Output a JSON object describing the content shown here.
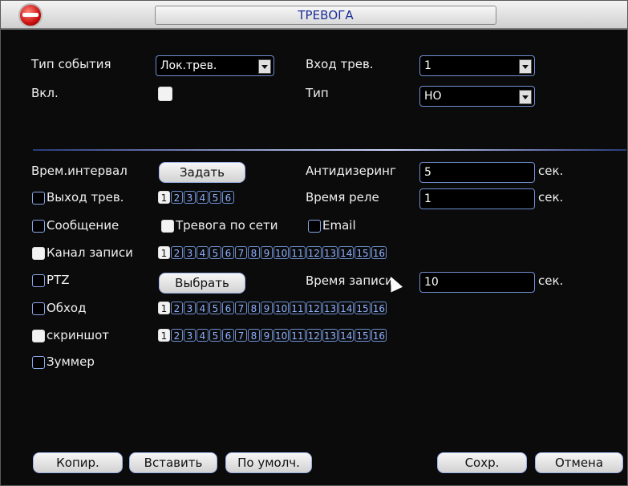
{
  "window": {
    "title": "ТРЕВОГА"
  },
  "row1": {
    "event_type_label": "Тип события",
    "event_type_value": "Лок.трев.",
    "alarm_in_label": "Вход трев.",
    "alarm_in_value": "1"
  },
  "row2": {
    "enable_label": "Вкл.",
    "type_label": "Тип",
    "type_value": "НО"
  },
  "period": {
    "label": "Врем.интервал",
    "button": "Задать",
    "debounce_label": "Антидизеринг",
    "debounce_value": "5",
    "debounce_unit": "сек."
  },
  "alarm_out": {
    "label": "Выход трев.",
    "channels": [
      "1",
      "2",
      "3",
      "4",
      "5",
      "6"
    ],
    "latch_label": "Время реле",
    "latch_value": "1",
    "latch_unit": "сек."
  },
  "notify": {
    "message_label": "Сообщение",
    "net_alarm_label": "Тревога по сети",
    "email_label": "Email"
  },
  "record_channel": {
    "label": "Канал записи",
    "channels": [
      "1",
      "2",
      "3",
      "4",
      "5",
      "6",
      "7",
      "8",
      "9",
      "10",
      "11",
      "12",
      "13",
      "14",
      "15",
      "16"
    ]
  },
  "ptz": {
    "label": "PTZ",
    "button": "Выбрать",
    "post_rec_label": "Время записи",
    "post_rec_value": "10",
    "post_rec_unit": "сек."
  },
  "tour": {
    "label": "Обход",
    "channels": [
      "1",
      "2",
      "3",
      "4",
      "5",
      "6",
      "7",
      "8",
      "9",
      "10",
      "11",
      "12",
      "13",
      "14",
      "15",
      "16"
    ]
  },
  "snapshot": {
    "label": "скриншот",
    "channels": [
      "1",
      "2",
      "3",
      "4",
      "5",
      "6",
      "7",
      "8",
      "9",
      "10",
      "11",
      "12",
      "13",
      "14",
      "15",
      "16"
    ]
  },
  "buzzer": {
    "label": "Зуммер"
  },
  "footer": {
    "copy": "Копир.",
    "paste": "Вставить",
    "default": "По умолч.",
    "save": "Сохр.",
    "cancel": "Отмена"
  },
  "colors": {
    "title_text": "#1a2d96",
    "accent_border": "#6f8fd0",
    "checked_fill": "#f2f2f2"
  },
  "icons": {
    "app": "dvr-logo-icon",
    "dropdown": "chevron-down-icon",
    "cursor": "mouse-pointer-icon"
  }
}
